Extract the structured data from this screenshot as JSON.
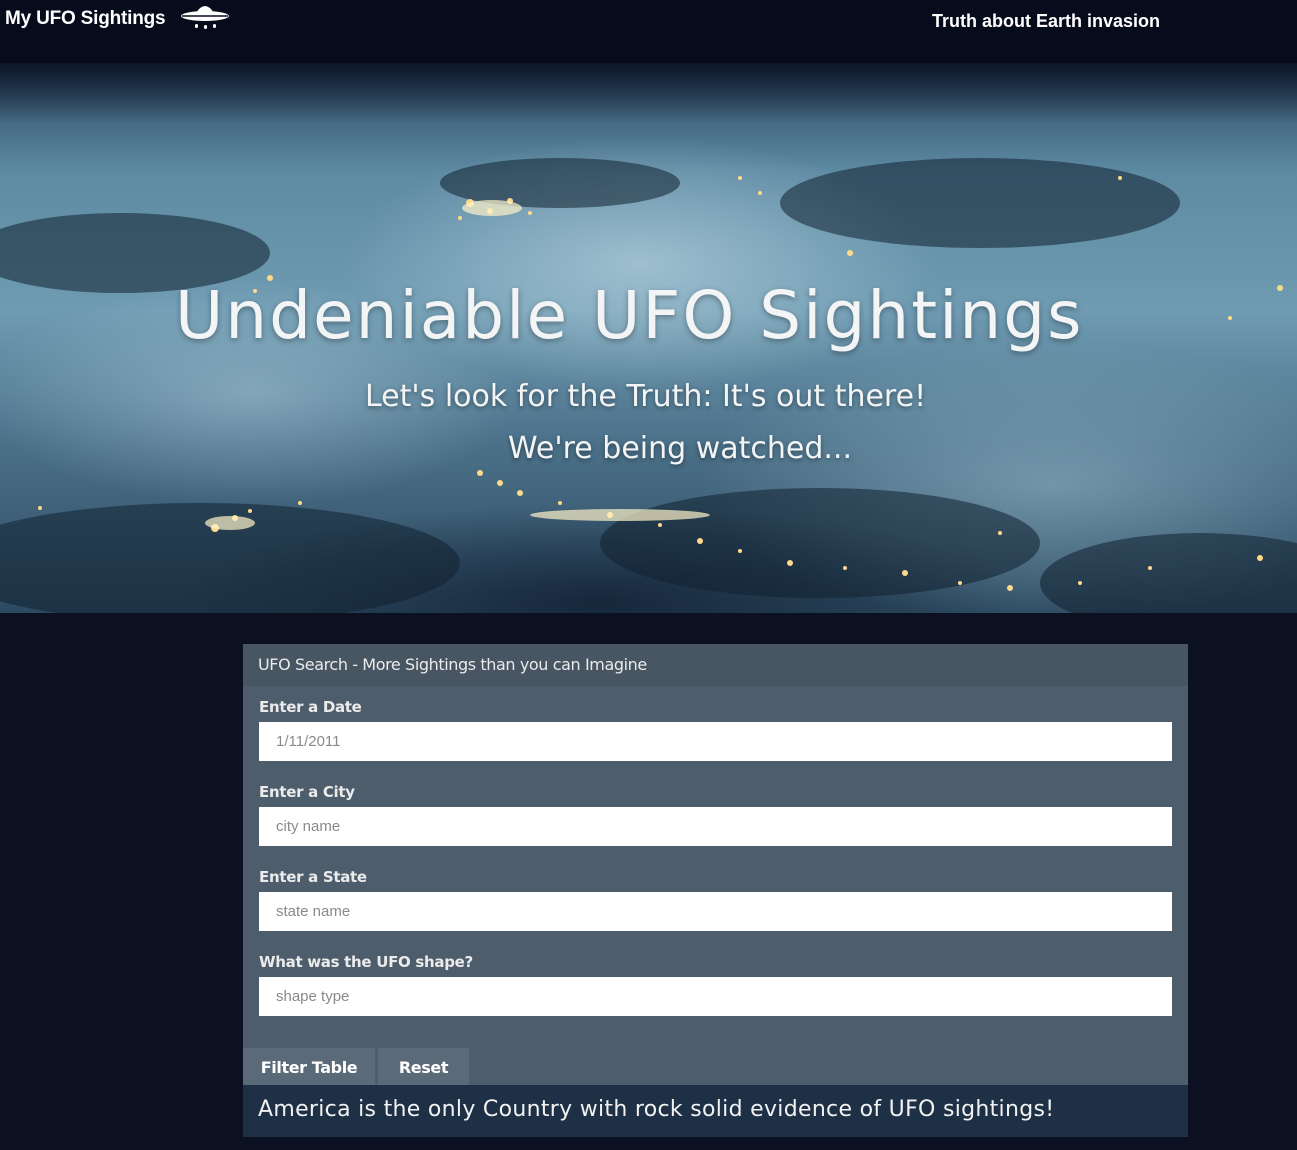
{
  "nav": {
    "brand": "My UFO Sightings",
    "link": "Truth about Earth invasion",
    "logo_icon": "ufo-icon"
  },
  "hero": {
    "title": "Undeniable UFO Sightings",
    "subtitle_1": "Let's look for the Truth: It's out there!",
    "subtitle_2": "We're being watched..."
  },
  "search": {
    "heading": "UFO Search - More Sightings than you can Imagine",
    "date_label": "Enter a Date",
    "date_placeholder": "1/11/2011",
    "city_label": "Enter a City",
    "city_placeholder": "city name",
    "state_label": "Enter a State",
    "state_placeholder": "state name",
    "shape_label": "What was the UFO shape?",
    "shape_placeholder": "shape type",
    "filter_button": "Filter Table",
    "reset_button": "Reset"
  },
  "evidence_text": "America is the only Country with rock solid evidence of UFO sightings!",
  "colors": {
    "page_background": "#0b1121",
    "navbar_background": "#070c1c",
    "panel_background": "#4e5d6c",
    "panel_heading_background": "#485563",
    "button_background": "#5b6a79",
    "evidence_background": "#1d3045"
  }
}
